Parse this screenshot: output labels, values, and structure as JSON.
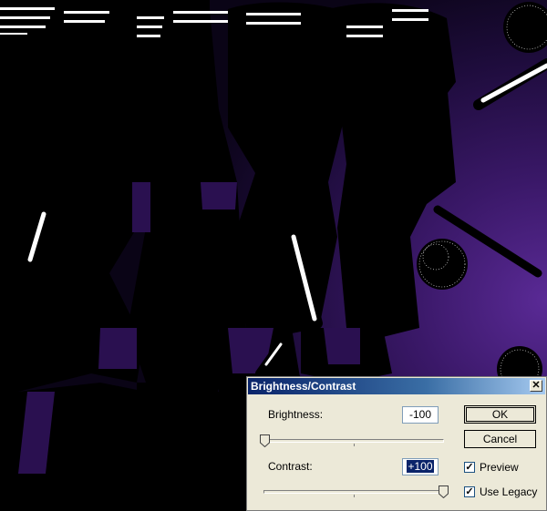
{
  "dialog": {
    "title": "Brightness/Contrast",
    "close_glyph": "✕",
    "brightness": {
      "label": "Brightness:",
      "value": "-100",
      "slider_fraction": 0.0
    },
    "contrast": {
      "label": "Contrast:",
      "value": "+100",
      "slider_fraction": 1.0
    },
    "ok_label": "OK",
    "cancel_label": "Cancel",
    "preview": {
      "label": "Preview",
      "checked": true
    },
    "use_legacy": {
      "label": "Use Legacy",
      "checked": true
    }
  },
  "colors": {
    "title_bar": "#0a246a",
    "dialog_face": "#ece9d8",
    "selection": "#0a246a",
    "canvas_purple": "#3a1868"
  },
  "icons": {
    "close": "close-icon",
    "check": "checkmark-icon"
  }
}
